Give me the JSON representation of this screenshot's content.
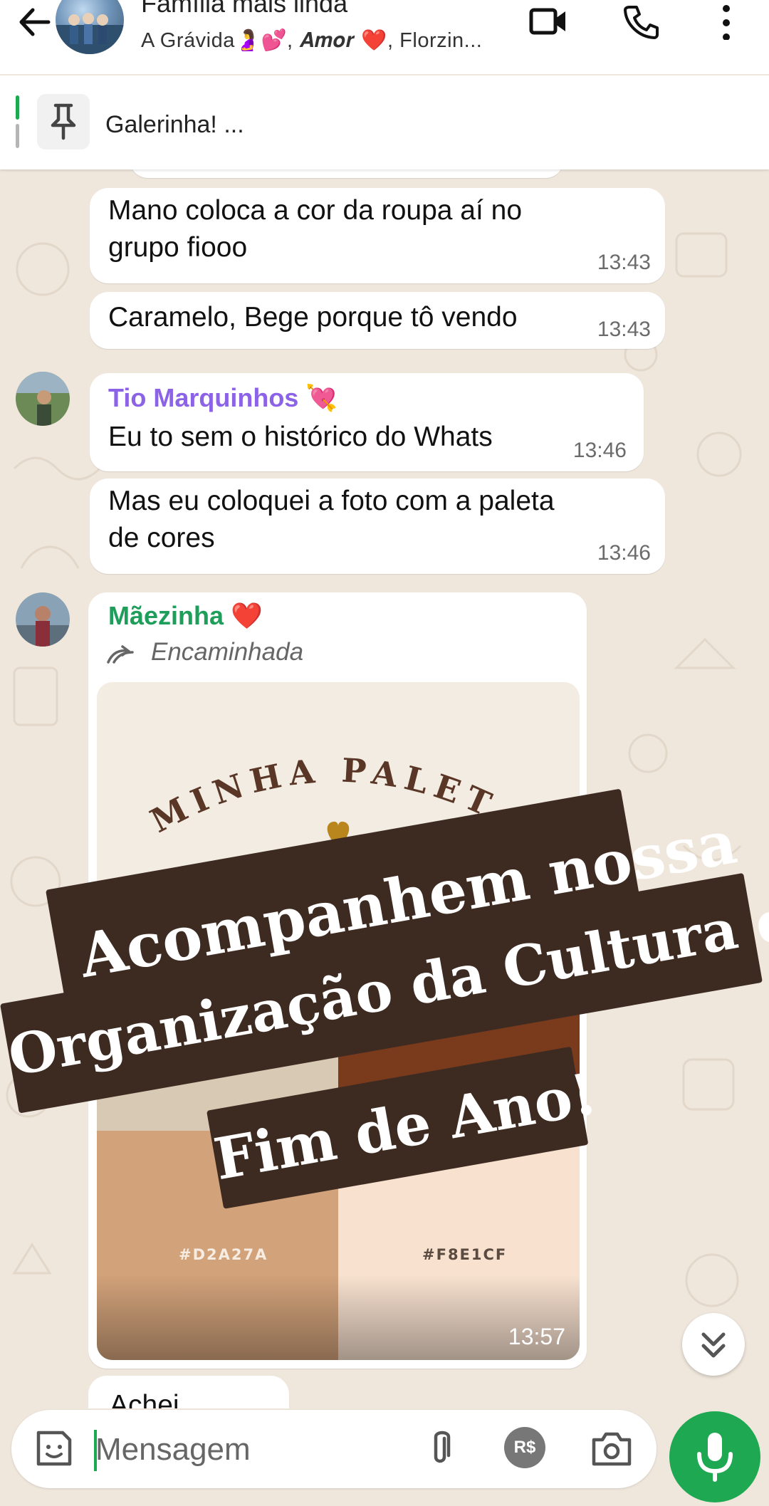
{
  "header": {
    "group_name": "Família mais linda",
    "members": "A Grávida🤰💕, 𝑨𝒎𝒐𝒓 ❤️, Florzin...",
    "icons": [
      "back-arrow-icon",
      "video-call-icon",
      "voice-call-icon",
      "more-options-icon"
    ]
  },
  "pinned": {
    "text": "Galerinha! ...",
    "icon": "pin-icon"
  },
  "messages": [
    {
      "text_1": "Mano coloca a cor da roupa aí no",
      "text_2": "grupo fiooo",
      "time": "13:43"
    },
    {
      "text": "Caramelo, Bege porque tô vendo",
      "time": "13:43"
    },
    {
      "sender": "Tio Marquinhos 💘",
      "sender_color": "#8c62e6",
      "text": "Eu to sem o histórico do Whats",
      "time": "13:46"
    },
    {
      "text_1": "Mas eu coloquei a foto com a paleta",
      "text_2": "de cores",
      "time": "13:46"
    },
    {
      "sender": "Mãezinha ❤️",
      "sender_color": "#1e9e5a",
      "forwarded": "Encaminhada",
      "time": "13:57",
      "image": {
        "title": "MINHA PALETA",
        "swatches": [
          {
            "hex_label": "#D2A27A",
            "color": "#d2a27a"
          },
          {
            "hex_label": "#F8E1CF",
            "color": "#f8e1cf"
          }
        ],
        "extra_colors": [
          "#d8c9b4",
          "#7a3b1d",
          "#c28d2c"
        ]
      }
    },
    {
      "text": "Achei"
    }
  ],
  "overlay": {
    "line_1": "Acompanhem nossa",
    "line_2": "Organização da Cultura de",
    "line_3": "Fim de Ano!",
    "bg_color": "#3d2b22"
  },
  "composer": {
    "placeholder": "Mensagem",
    "icons": [
      "sticker-icon",
      "attach-icon",
      "payment-icon",
      "camera-icon",
      "microphone-icon"
    ],
    "payment_label": "R$"
  },
  "colors": {
    "accent": "#1da851",
    "chat_bg": "#efe7dc"
  }
}
